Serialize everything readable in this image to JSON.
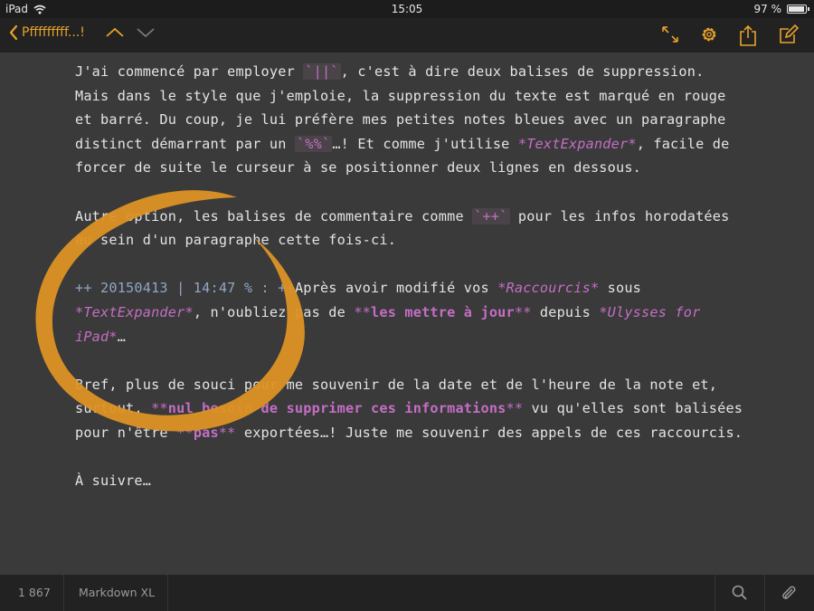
{
  "status": {
    "device": "iPad",
    "time": "15:05",
    "battery": "97 %",
    "battery_level": 0.97
  },
  "toolbar": {
    "back_label": "Pfffffffff...!"
  },
  "editor": {
    "p1": {
      "t1": "J'ai commencé par employer ",
      "c1": "`||`",
      "t2": ", c'est à dire deux balises de suppression. Mais dans le style que j'emploie, la suppression du texte est marqué en rouge et barré. Du coup, je lui préfère mes petites notes bleues avec un paragraphe distinct démarrant par un ",
      "c2": "`%%`",
      "t3": "…! Et comme j'utilise ",
      "e1": "*TextExpander*",
      "t4": ", facile de forcer de suite le curseur à se positionner deux lignes en dessous."
    },
    "p2": {
      "t1": "Autre option, les balises de commentaire comme ",
      "c1": "`++`",
      "t2": " pour les infos horodatées au sein d'un paragraphe cette fois-ci."
    },
    "p3": {
      "comment": "++ 20150413 | 14:47 % : ++",
      "t1": "Après avoir modifié vos ",
      "e1": "*Raccourcis*",
      "t2": " sous ",
      "e2": "*TextExpander*",
      "t3": ", n'oubliez pas de ",
      "s1_open": "**",
      "s1_text": "les mettre à jour",
      "s1_close": "**",
      "t4": " depuis ",
      "e3": "*Ulysses for iPad*",
      "t5": "…"
    },
    "p4": {
      "t1": "Bref, plus de souci pour me souvenir de la date et de l'heure de la note et, surtout, ",
      "s1_open": "**",
      "s1_text": "nul besoin de supprimer ces informations",
      "s1_close": "**",
      "t2": " vu qu'elles sont balisées pour n'être ",
      "s2_open": "**",
      "s2_text": "pas",
      "s2_close": "**",
      "t3": " exportées…! Juste me souvenir des appels de ces raccourcis."
    },
    "p5": "À suivre…"
  },
  "bottom": {
    "count": "1 867",
    "markup": "Markdown XL"
  },
  "colors": {
    "accent": "#e8a12a",
    "markup": "#c46ec4",
    "comment": "#8fa6c4",
    "swirl": "#dc9224"
  }
}
